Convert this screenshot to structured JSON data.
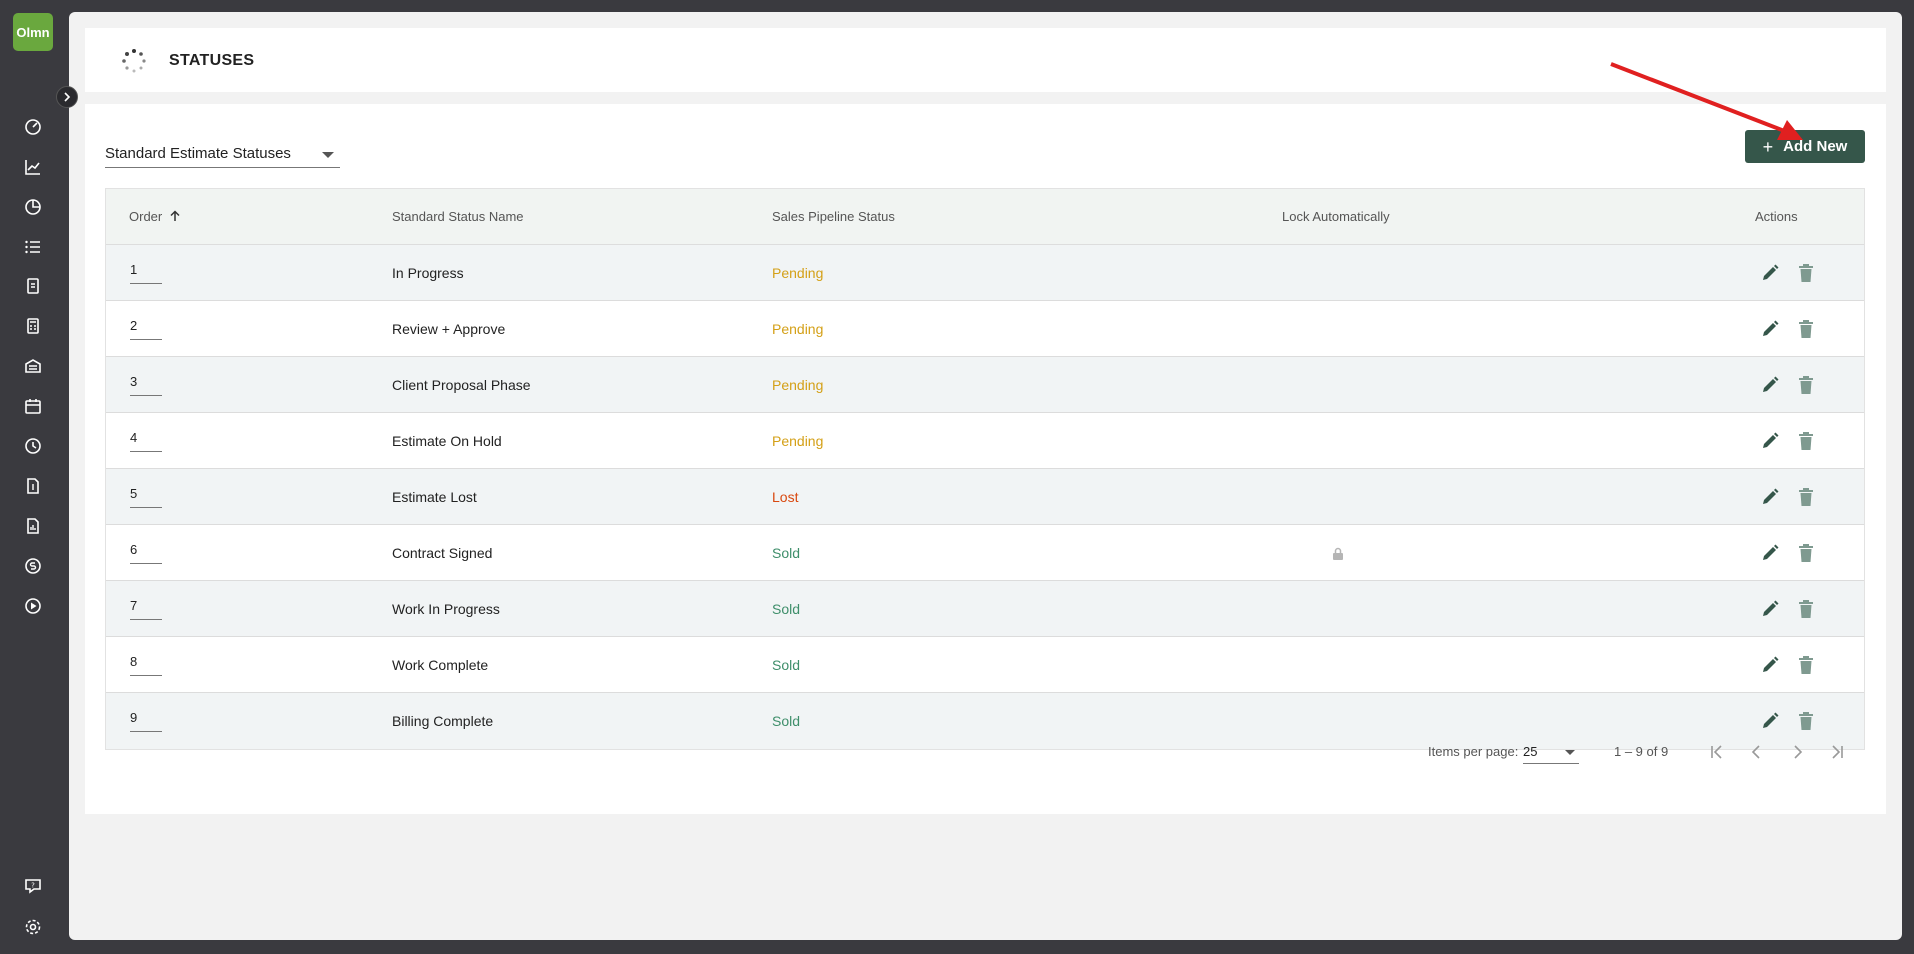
{
  "app": {
    "logo_text": "Olmn",
    "accent_color": "#6aa83e",
    "primary_color": "#35564a"
  },
  "sidebar": {
    "icons": [
      {
        "name": "dashboard-icon"
      },
      {
        "name": "chart-line-icon"
      },
      {
        "name": "pie-chart-icon"
      },
      {
        "name": "list-icon"
      },
      {
        "name": "clipboard-icon"
      },
      {
        "name": "calculator-icon"
      },
      {
        "name": "warehouse-icon"
      },
      {
        "name": "calendar-icon"
      },
      {
        "name": "clock-icon"
      },
      {
        "name": "invoice-icon"
      },
      {
        "name": "report-icon"
      },
      {
        "name": "money-icon"
      },
      {
        "name": "play-icon"
      }
    ],
    "bottom_icons": [
      {
        "name": "help-icon"
      },
      {
        "name": "settings-gear-icon"
      }
    ]
  },
  "header": {
    "title": "STATUSES"
  },
  "filter": {
    "selected": "Standard Estimate Statuses"
  },
  "toolbar": {
    "add_label": "Add New",
    "add_plus": "+"
  },
  "table": {
    "columns": {
      "order": "Order",
      "name": "Standard Status Name",
      "pipeline": "Sales Pipeline Status",
      "lock": "Lock Automatically",
      "actions": "Actions"
    },
    "sort": {
      "column": "order",
      "direction": "ascending"
    },
    "rows": [
      {
        "order": "1",
        "name": "In Progress",
        "pipeline": "Pending",
        "locked": false
      },
      {
        "order": "2",
        "name": "Review + Approve",
        "pipeline": "Pending",
        "locked": false
      },
      {
        "order": "3",
        "name": "Client Proposal Phase",
        "pipeline": "Pending",
        "locked": false
      },
      {
        "order": "4",
        "name": "Estimate On Hold",
        "pipeline": "Pending",
        "locked": false
      },
      {
        "order": "5",
        "name": "Estimate Lost",
        "pipeline": "Lost",
        "locked": false
      },
      {
        "order": "6",
        "name": "Contract Signed",
        "pipeline": "Sold",
        "locked": true
      },
      {
        "order": "7",
        "name": "Work In Progress",
        "pipeline": "Sold",
        "locked": false
      },
      {
        "order": "8",
        "name": "Work Complete",
        "pipeline": "Sold",
        "locked": false
      },
      {
        "order": "9",
        "name": "Billing Complete",
        "pipeline": "Sold",
        "locked": false
      }
    ],
    "status_colors": {
      "Pending": "#d4a017",
      "Lost": "#d9480f",
      "Sold": "#3e8e6a"
    }
  },
  "paginator": {
    "items_per_page_label": "Items per page:",
    "items_per_page": "25",
    "range": "1 – 9 of 9"
  },
  "annotation": {
    "arrow_color": "#e02020"
  }
}
